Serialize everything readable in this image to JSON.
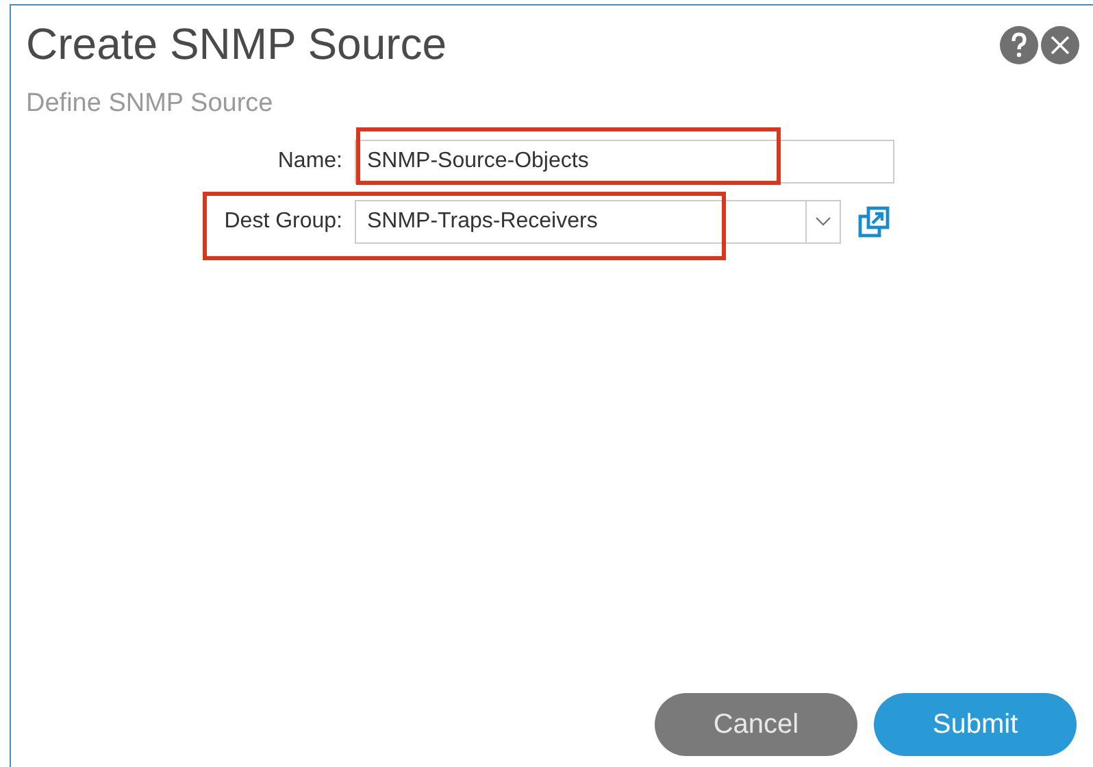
{
  "dialog": {
    "title": "Create SNMP Source",
    "subtitle": "Define SNMP Source"
  },
  "fields": [
    {
      "kind": "text",
      "label": "Name:",
      "value": "SNMP-Source-Objects",
      "highlighted": true
    },
    {
      "kind": "select",
      "label": "Dest Group:",
      "value": "SNMP-Traps-Receivers",
      "highlighted": true
    }
  ],
  "buttons": [
    {
      "label": "Cancel",
      "kind": "secondary"
    },
    {
      "label": "Submit",
      "kind": "primary"
    }
  ]
}
